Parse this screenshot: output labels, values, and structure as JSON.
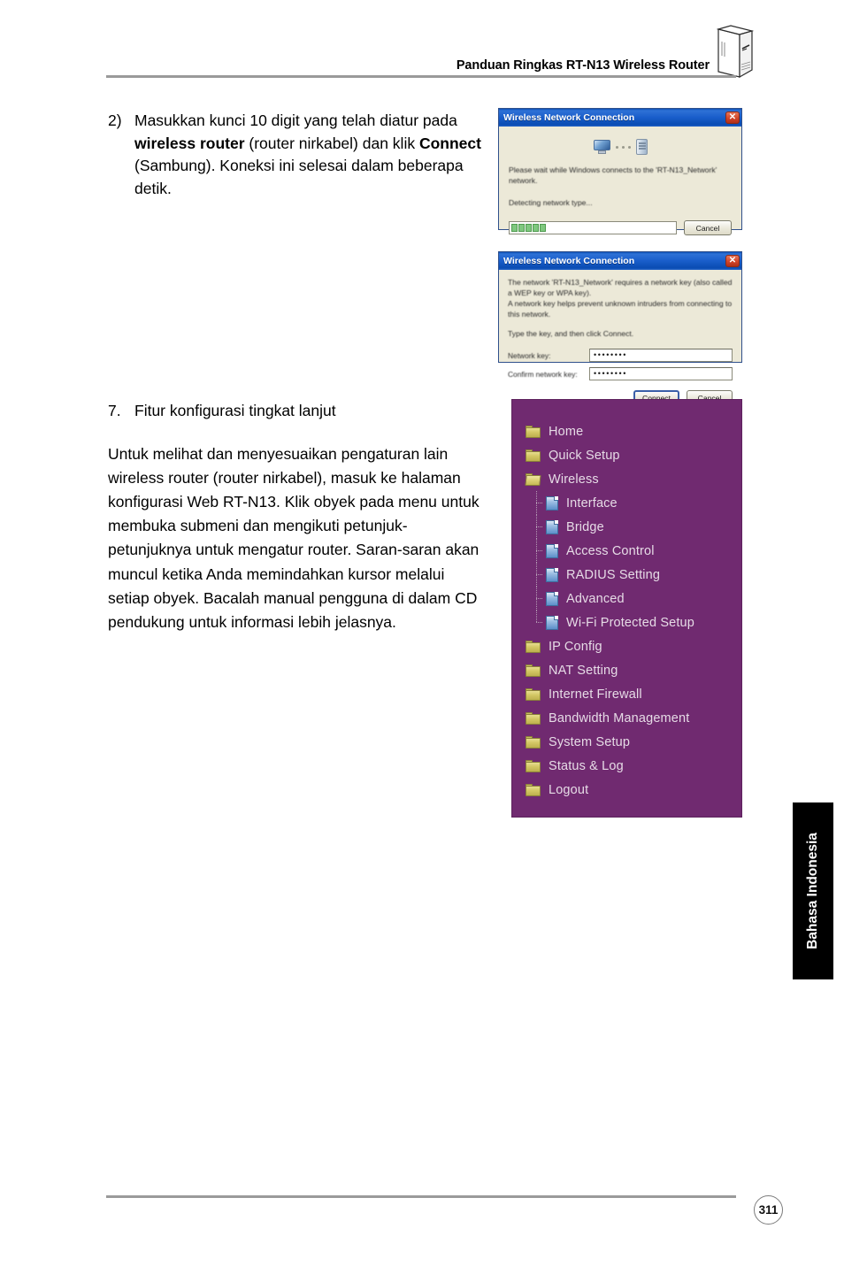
{
  "header": {
    "title": "Panduan Ringkas RT-N13 Wireless Router",
    "router_icon": "router-illustration"
  },
  "step2": {
    "number": "2)",
    "text_part1": "Masukkan kunci 10 digit yang telah diatur pada ",
    "bold1": "wireless router",
    "text_part2": " (router nirkabel) dan klik ",
    "bold2": "Connect",
    "text_part3": " (Sambung). Koneksi ini selesai dalam beberapa detik."
  },
  "section7": {
    "number": "7.",
    "heading": "Fitur konfigurasi tingkat lanjut",
    "paragraph": "Untuk melihat dan menyesuaikan pengaturan lain wireless router (router nirkabel), masuk ke halaman konfigurasi Web RT-N13. Klik obyek pada menu untuk membuka submeni dan mengikuti petunjuk-petunjuknya untuk mengatur router. Saran-saran akan muncul ketika Anda memindahkan kursor melalui setiap obyek. Bacalah manual pengguna di dalam CD pendukung untuk informasi lebih jelasnya."
  },
  "dialog_connecting": {
    "title": "Wireless Network Connection",
    "close_label": "✕",
    "status_line1": "Please wait while Windows connects to the 'RT-N13_Network' network.",
    "status_line2": "Detecting network type...",
    "cancel_label": "Cancel",
    "progress_blocks": 5
  },
  "dialog_network_key": {
    "title": "Wireless Network Connection",
    "close_label": "✕",
    "description_line1": "The network 'RT-N13_Network' requires a network key (also called a WEP key or WPA key).",
    "description_line2": "A network key helps prevent unknown intruders from connecting to this network.",
    "instruction": "Type the key, and then click Connect.",
    "field_network_key_label": "Network key:",
    "field_network_key_value": "••••••••",
    "field_confirm_key_label": "Confirm network key:",
    "field_confirm_key_value": "••••••••",
    "connect_label": "Connect",
    "cancel_label": "Cancel"
  },
  "router_menu": {
    "background_color": "#702a70",
    "text_color": "#e6dbe6",
    "items": [
      {
        "label": "Home",
        "icon": "folder-icon",
        "level": 0
      },
      {
        "label": "Quick Setup",
        "icon": "folder-icon",
        "level": 0
      },
      {
        "label": "Wireless",
        "icon": "folder-open-icon",
        "level": 0
      },
      {
        "label": "Interface",
        "icon": "document-icon",
        "level": 1
      },
      {
        "label": "Bridge",
        "icon": "document-icon",
        "level": 1
      },
      {
        "label": "Access Control",
        "icon": "document-icon",
        "level": 1
      },
      {
        "label": "RADIUS Setting",
        "icon": "document-icon",
        "level": 1
      },
      {
        "label": "Advanced",
        "icon": "document-icon",
        "level": 1
      },
      {
        "label": "Wi-Fi Protected Setup",
        "icon": "document-icon",
        "level": 1
      },
      {
        "label": "IP Config",
        "icon": "folder-icon",
        "level": 0
      },
      {
        "label": "NAT Setting",
        "icon": "folder-icon",
        "level": 0
      },
      {
        "label": "Internet Firewall",
        "icon": "folder-icon",
        "level": 0
      },
      {
        "label": "Bandwidth Management",
        "icon": "folder-icon",
        "level": 0
      },
      {
        "label": "System Setup",
        "icon": "folder-icon",
        "level": 0
      },
      {
        "label": "Status & Log",
        "icon": "folder-icon",
        "level": 0
      },
      {
        "label": "Logout",
        "icon": "folder-icon",
        "level": 0
      }
    ]
  },
  "side_tab": {
    "label": "Bahasa Indonesia"
  },
  "footer": {
    "page_number": "311"
  }
}
